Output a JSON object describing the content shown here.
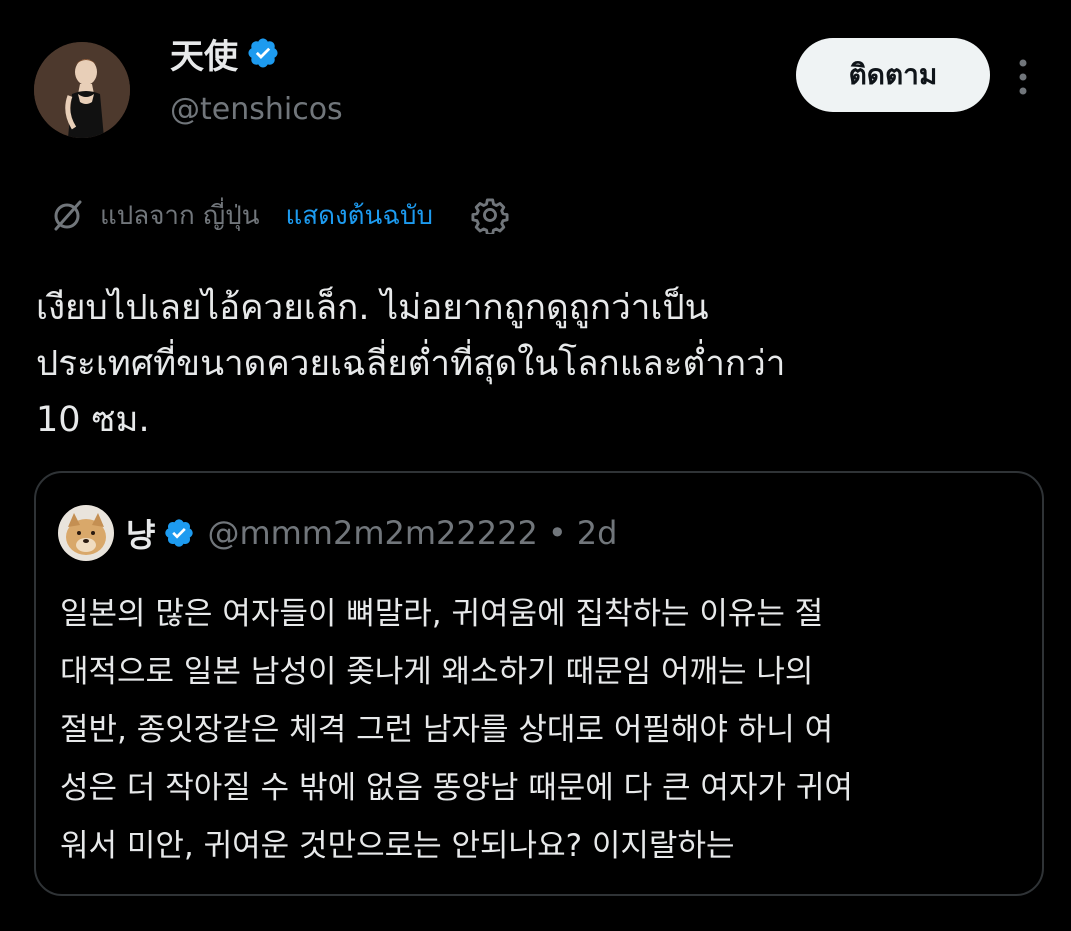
{
  "author": {
    "display_name": "天使",
    "handle": "@tenshicos",
    "avatar_icon": "portrait-avatar",
    "verified_icon": "verified-badge-icon"
  },
  "actions": {
    "follow_label": "ติดตาม",
    "more_icon": "more-vertical-icon"
  },
  "translation": {
    "icon": "translate-icon",
    "translated_from": "แปลจาก ญี่ปุ่น",
    "show_original": "แสดงต้นฉบับ",
    "settings_icon": "gear-icon"
  },
  "tweet": {
    "text": "เงียบไปเลยไอ้ควยเล็ก. ไม่อยากถูกดูถูกว่าเป็น\nประเทศที่ขนาดควยเฉลี่ยต่ำที่สุดในโลกและต่ำกว่า\n10 ซม."
  },
  "quote": {
    "display_name": "냥",
    "handle": "@mmm2m2m22222",
    "separator": "•",
    "time": "2d",
    "avatar_icon": "dog-avatar",
    "text": "일본의 많은 여자들이 뼈말라, 귀여움에 집착하는 이유는 절\n대적으로 일본 남성이 좆나게 왜소하기 때문임 어깨는 나의\n절반, 종잇장같은 체격 그런 남자를 상대로 어필해야 하니 여\n성은 더 작아질 수 밖에 없음 똥양남 때문에 다 큰 여자가 귀여\n워서 미안, 귀여운 것만으로는 안되나요? 이지랄하는"
  },
  "colors": {
    "background": "#000000",
    "text_primary": "#e7e9ea",
    "text_secondary": "#71767b",
    "accent_blue": "#1d9bf0",
    "border": "#2f3336",
    "follow_bg": "#eff3f4"
  }
}
